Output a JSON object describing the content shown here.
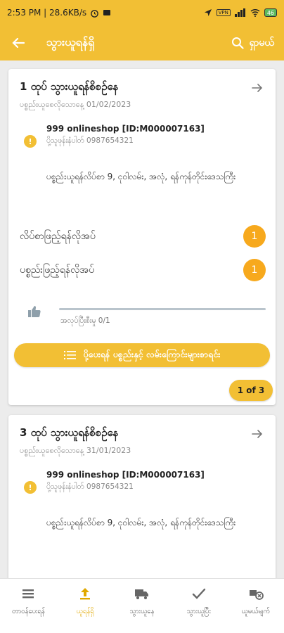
{
  "status_bar": {
    "time_speed": "2:53 PM | 28.6KB/s",
    "vpn": "VPN",
    "battery": "46"
  },
  "app_bar": {
    "title": "သွားယူရန်ရှိ",
    "search_label": "ရှာမယ်"
  },
  "cards": [
    {
      "title": "1 ထုပ် သွားယူရန်စိစဉ်နေ",
      "pickup_date": "ပစ္စည်းယူစေလိုသောနေ့ 01/02/2023",
      "shop_index": "!",
      "shop_name": "999 onlineshop [ID:M000007163]",
      "shop_phone": "ပို့သူဖုန်းနံပါတ် 0987654321",
      "address": "ပစ္စည်းယူရန်လိပ်စာ 9, ငုဝါလမ်း, အလုံ, ရန်ကုန်တိုင်းဒေသကြီး",
      "requests": [
        {
          "label": "လိပ်စာဖြည့်ရန်လိုအပ်",
          "count": "1"
        },
        {
          "label": "ပစ္စည်းဖြည့်ရန်လိုအပ်",
          "count": "1"
        }
      ],
      "progress_text": "အလုပ်ပြီးစီးမှု 0/1",
      "progress_fraction": 0,
      "list_button": "ပို့ပေးရန် ပစ္စည်းနှင့် လမ်းကြောင်းများစာရင်း",
      "pager": "1 of 3"
    },
    {
      "title": "3 ထုပ် သွားယူရန်စိစဉ်နေ",
      "pickup_date": "ပစ္စည်းယူစေလိုသောနေ့ 31/01/2023",
      "shop_index": "!",
      "shop_name": "999 onlineshop [ID:M000007163]",
      "shop_phone": "ပို့သူဖုန်းနံပါတ် 0987654321",
      "address": "ပစ္စည်းယူရန်လိပ်စာ 9, ငုဝါလမ်း, အလုံ, ရန်ကုန်တိုင်းဒေသကြီး"
    }
  ],
  "bottom_nav": [
    {
      "label": "တာဝန်ပေးရန်",
      "icon": "list-icon",
      "active": false
    },
    {
      "label": "ယူရန်ရှိ",
      "icon": "upload-icon",
      "active": true
    },
    {
      "label": "သွားယူနေ",
      "icon": "truck-icon",
      "active": false
    },
    {
      "label": "သွားယူပြီး",
      "icon": "check-icon",
      "active": false
    },
    {
      "label": "ယူမယ်မျက်",
      "icon": "cancel-delivery-icon",
      "active": false
    }
  ],
  "colors": {
    "primary": "#f2bf34",
    "badge": "#f7a91d",
    "muted_text": "#8a8a8a"
  }
}
